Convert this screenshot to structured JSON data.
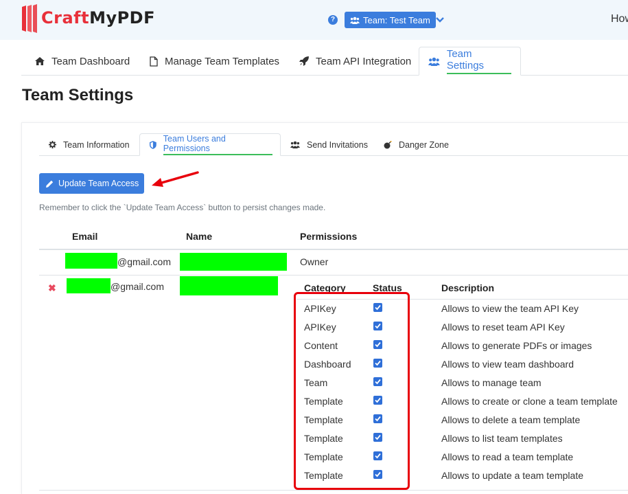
{
  "header": {
    "logo_part1": "Craft",
    "logo_part2": "MyPDF",
    "help_icon": "?",
    "team_selector": "Team: Test Team",
    "right_text": "How"
  },
  "main_tabs": [
    {
      "label": "Team Dashboard",
      "icon": "home-icon"
    },
    {
      "label": "Manage Team Templates",
      "icon": "file-icon"
    },
    {
      "label": "Team API Integration",
      "icon": "rocket-icon"
    },
    {
      "label": "Team Settings",
      "icon": "users-icon",
      "active": true
    }
  ],
  "page_title": "Team Settings",
  "sub_tabs": [
    {
      "label": "Team Information",
      "icon": "gear-icon"
    },
    {
      "label": "Team Users and Permissions",
      "icon": "shield-icon",
      "active": true
    },
    {
      "label": "Send Invitations",
      "icon": "users-icon"
    },
    {
      "label": "Danger Zone",
      "icon": "bomb-icon"
    }
  ],
  "update_button": "Update Team Access",
  "note": "Remember to click the `Update Team Access` button to persist changes made.",
  "users_table": {
    "headers": {
      "email": "Email",
      "name": "Name",
      "permissions": "Permissions"
    },
    "rows": [
      {
        "email_suffix": "@gmail.com",
        "permission": "Owner"
      },
      {
        "email_suffix": "@gmail.com",
        "delete_icon": "✖"
      }
    ]
  },
  "permissions_table": {
    "headers": {
      "category": "Category",
      "status": "Status",
      "description": "Description"
    },
    "rows": [
      {
        "category": "APIKey",
        "checked": true,
        "description": "Allows to view the team API Key"
      },
      {
        "category": "APIKey",
        "checked": true,
        "description": "Allows to reset team API Key"
      },
      {
        "category": "Content",
        "checked": true,
        "description": "Allows to generate PDFs or images"
      },
      {
        "category": "Dashboard",
        "checked": true,
        "description": "Allows to view team dashboard"
      },
      {
        "category": "Team",
        "checked": true,
        "description": "Allows to manage team"
      },
      {
        "category": "Template",
        "checked": true,
        "description": "Allows to create or clone a team template"
      },
      {
        "category": "Template",
        "checked": true,
        "description": "Allows to delete a team template"
      },
      {
        "category": "Template",
        "checked": true,
        "description": "Allows to list team templates"
      },
      {
        "category": "Template",
        "checked": true,
        "description": "Allows to read a team template"
      },
      {
        "category": "Template",
        "checked": true,
        "description": "Allows to update a team template"
      }
    ]
  },
  "colors": {
    "accent": "#3b7ddd",
    "brand_red": "#e8303a",
    "active_underline": "#3bbd5a",
    "redaction": "#00ff00",
    "annotation_red": "#e8000b"
  }
}
